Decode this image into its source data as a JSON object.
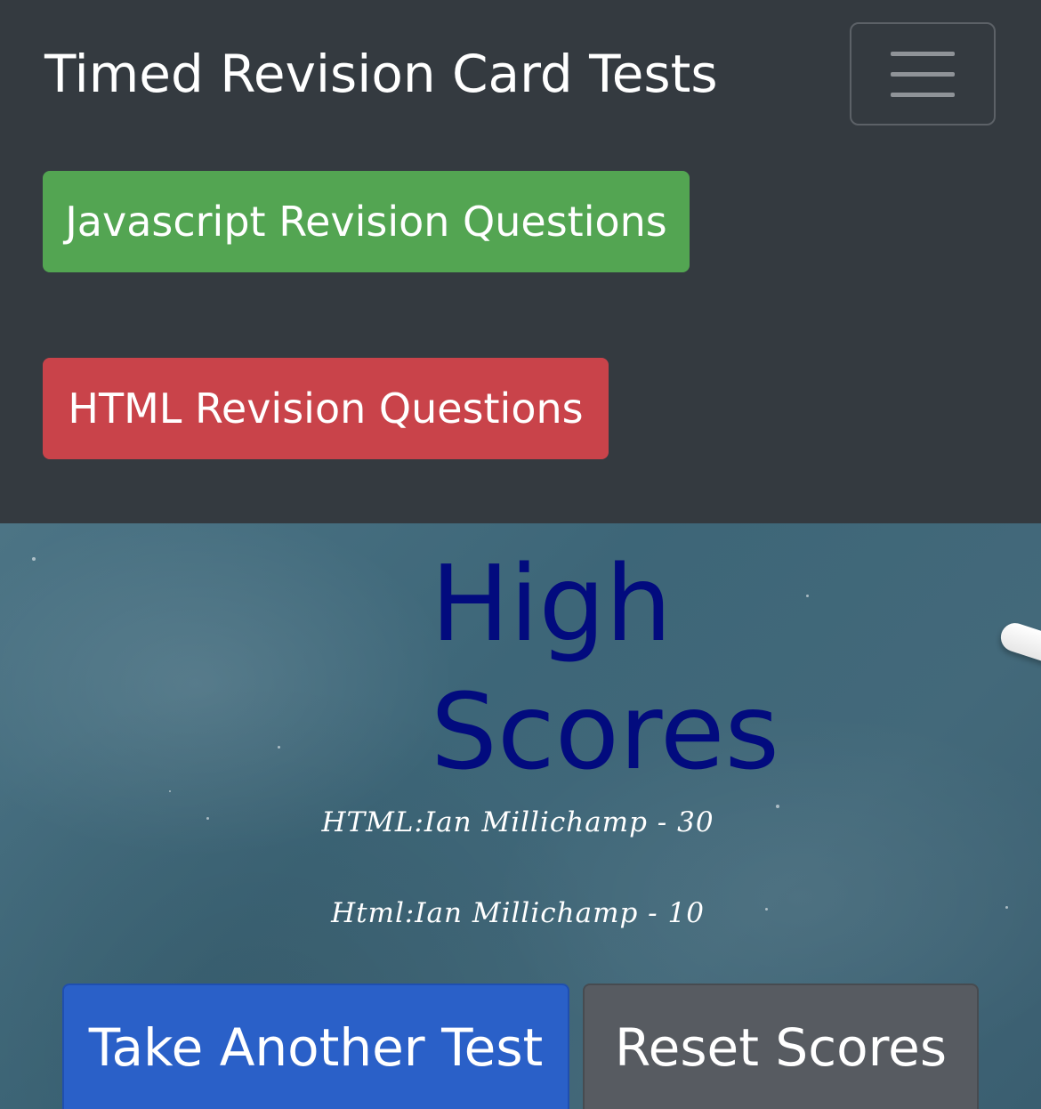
{
  "navbar": {
    "brand": "Timed Revision Card Tests",
    "toggler_icon": "hamburger-menu-icon",
    "links": [
      {
        "label": "Javascript Revision Questions",
        "color": "#53a552"
      },
      {
        "label": "HTML Revision Questions",
        "color": "#c9434a"
      }
    ]
  },
  "main": {
    "heading": "High Scores",
    "scores": [
      "HTML:Ian Millichamp - 30",
      "Html:Ian Millichamp - 10"
    ],
    "buttons": {
      "take_another": "Take Another Test",
      "reset": "Reset Scores"
    },
    "colors": {
      "heading": "#020b7e",
      "take_another": "#2a60c8",
      "reset": "#575b61",
      "navbar_bg": "#343a40"
    }
  }
}
